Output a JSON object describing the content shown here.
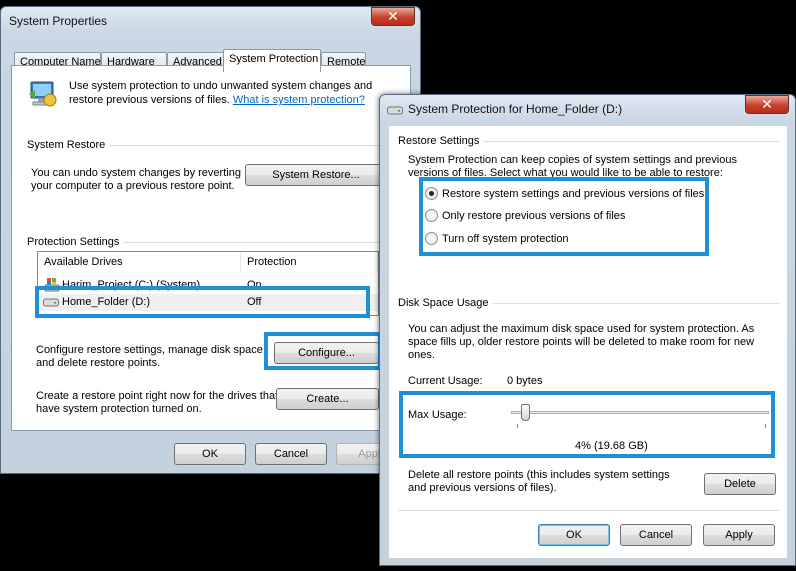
{
  "sysprops": {
    "title": "System Properties",
    "close": "✕",
    "tabs": [
      "Computer Name",
      "Hardware",
      "Advanced",
      "System Protection",
      "Remote"
    ],
    "intro_line1": "Use system protection to undo unwanted system changes and",
    "intro_line2": "restore previous versions of files.",
    "intro_link": "What is system protection?",
    "restore_heading": "System Restore",
    "restore_line1": "You can undo system changes by reverting",
    "restore_line2": "your computer to a previous restore point.",
    "restore_button": "System Restore...",
    "protection_heading": "Protection Settings",
    "columns": [
      "Available Drives",
      "Protection"
    ],
    "drives": [
      {
        "name": "Harim_Project (C:) (System)",
        "protection": "On"
      },
      {
        "name": "Home_Folder (D:)",
        "protection": "Off"
      }
    ],
    "configure_line1": "Configure restore settings, manage disk space,",
    "configure_line2": "and delete restore points.",
    "configure_button": "Configure...",
    "create_line1": "Create a restore point right now for the drives that",
    "create_line2": "have system protection turned on.",
    "create_button": "Create...",
    "ok": "OK",
    "cancel": "Cancel",
    "apply": "Apply"
  },
  "protection": {
    "title": "System Protection for Home_Folder (D:)",
    "close": "✕",
    "restore_heading": "Restore Settings",
    "restore_desc1": "System Protection can keep copies of system settings and previous",
    "restore_desc2": "versions of files. Select what you would like to be able to restore:",
    "options": [
      "Restore system settings and previous versions of files",
      "Only restore previous versions of files",
      "Turn off system protection"
    ],
    "selected_option": 0,
    "disk_heading": "Disk Space Usage",
    "disk_desc1": "You can adjust the maximum disk space used for system protection. As",
    "disk_desc2": "space fills up, older restore points will be deleted to make room for new",
    "disk_desc3": "ones.",
    "current_usage_label": "Current Usage:",
    "current_usage_value": "0 bytes",
    "max_usage_label": "Max Usage:",
    "max_usage_percent": 4,
    "max_usage_value": "4% (19.68 GB)",
    "delete_line1": "Delete all restore points (this includes system settings",
    "delete_line2": "and previous versions of files).",
    "delete_button": "Delete",
    "ok": "OK",
    "cancel": "Cancel",
    "apply": "Apply"
  },
  "colors": {
    "highlight": "#1e90d6",
    "link": "#0066cc"
  },
  "icons": [
    "system-protection-icon",
    "hard-drive-icon",
    "system-drive-icon"
  ]
}
